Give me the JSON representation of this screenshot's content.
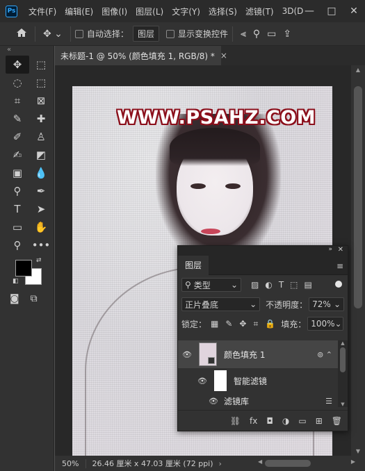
{
  "app": {
    "logo": "Ps",
    "menu": [
      "文件(F)",
      "编辑(E)",
      "图像(I)",
      "图层(L)",
      "文字(Y)",
      "选择(S)",
      "滤镜(T)",
      "3D(D"
    ],
    "window_controls": [
      "—",
      "□",
      "✕"
    ]
  },
  "options_bar": {
    "home_icon": "home-icon",
    "auto_select_label": "自动选择：",
    "auto_select_value": "图层",
    "show_transform_label": "显示变换控件"
  },
  "toolbar": {
    "collapse": "«",
    "tools": [
      {
        "name": "move-tool",
        "glyph": "✥"
      },
      {
        "name": "marquee-tool",
        "glyph": "⬚"
      },
      {
        "name": "lasso-tool",
        "glyph": "◌"
      },
      {
        "name": "object-select-tool",
        "glyph": "⬚"
      },
      {
        "name": "crop-tool",
        "glyph": "⌗"
      },
      {
        "name": "frame-tool",
        "glyph": "⊠"
      },
      {
        "name": "eyedropper-tool",
        "glyph": "✎"
      },
      {
        "name": "healing-brush-tool",
        "glyph": "✚"
      },
      {
        "name": "brush-tool",
        "glyph": "✐"
      },
      {
        "name": "clone-stamp-tool",
        "glyph": "♙"
      },
      {
        "name": "history-brush-tool",
        "glyph": "✍"
      },
      {
        "name": "eraser-tool",
        "glyph": "◩"
      },
      {
        "name": "gradient-tool",
        "glyph": "▣"
      },
      {
        "name": "blur-tool",
        "glyph": "💧"
      },
      {
        "name": "dodge-tool",
        "glyph": "⚲"
      },
      {
        "name": "pen-tool",
        "glyph": "✒"
      },
      {
        "name": "type-tool",
        "glyph": "T"
      },
      {
        "name": "path-select-tool",
        "glyph": "➤"
      },
      {
        "name": "rectangle-tool",
        "glyph": "▭"
      },
      {
        "name": "hand-tool",
        "glyph": "✋"
      },
      {
        "name": "zoom-tool",
        "glyph": "⚲"
      },
      {
        "name": "more-tools",
        "glyph": "•••"
      }
    ],
    "foreground_color": "#000000",
    "background_color": "#ffffff"
  },
  "document_tab": {
    "title": "未标题-1 @ 50% (颜色填充 1, RGB/8) *",
    "close": "×"
  },
  "canvas": {
    "watermark": "WWW.PSAHZ.COM"
  },
  "status_bar": {
    "zoom": "50%",
    "doc_info": "26.46 厘米 x 47.03 厘米 (72 ppi)",
    "caret": "›"
  },
  "layers_panel": {
    "tab_label": "图层",
    "filter_kind": "类型",
    "blend_mode": "正片叠底",
    "opacity_label": "不透明度：",
    "opacity_value": "72%",
    "lock_label": "锁定：",
    "fill_label": "填充：",
    "fill_value": "100%",
    "layers": [
      {
        "name": "颜色填充 1",
        "selected": true
      },
      {
        "name": "智能滤镜",
        "selected": false
      },
      {
        "name": "滤镜库",
        "selected": false
      }
    ]
  }
}
